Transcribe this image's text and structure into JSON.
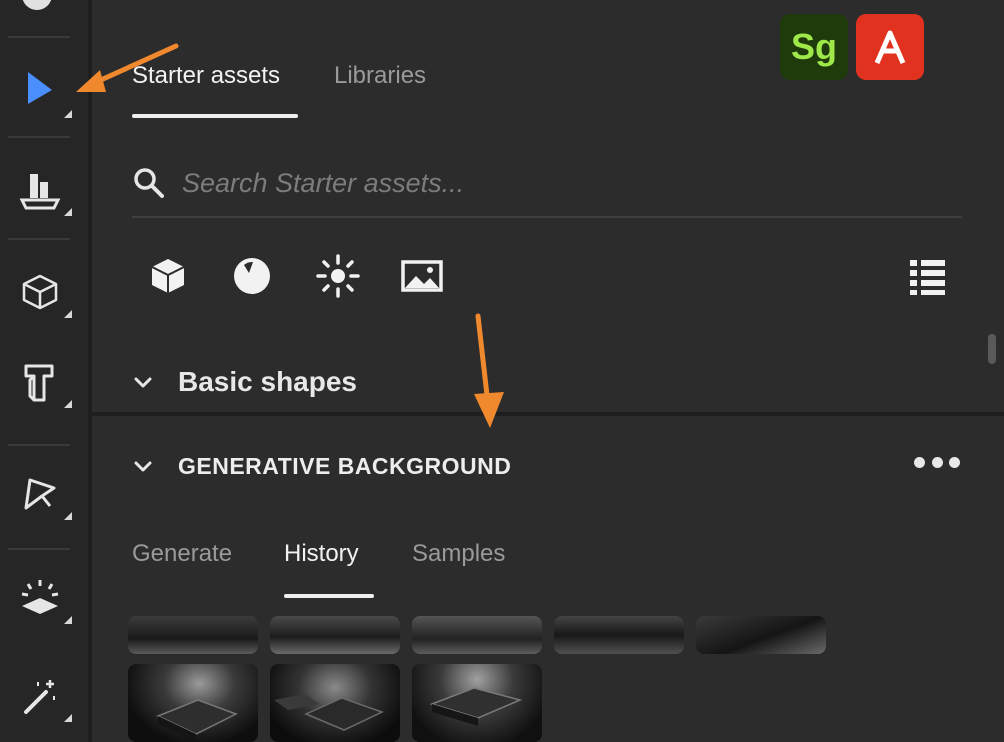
{
  "tabs": [
    {
      "label": "Starter assets",
      "active": true
    },
    {
      "label": "Libraries",
      "active": false
    }
  ],
  "search": {
    "placeholder": "Search Starter assets..."
  },
  "filters": [
    "shape-icon",
    "material-icon",
    "light-icon",
    "environment-icon"
  ],
  "sections": {
    "basic_shapes": {
      "title": "Basic shapes",
      "expanded": false
    },
    "generative_background": {
      "title": "GENERATIVE BACKGROUND",
      "expanded": true
    }
  },
  "sub_tabs": [
    {
      "label": "Generate",
      "active": false
    },
    {
      "label": "History",
      "active": true
    },
    {
      "label": "Samples",
      "active": false
    }
  ],
  "badges": {
    "substance": {
      "text": "Sg",
      "bg": "#1f3a0b",
      "fg": "#9fe84a"
    },
    "adobe": {
      "bg": "#e1321f"
    }
  },
  "toolbar": {
    "tools": [
      "select-tool-icon",
      "stage-tool-icon",
      "cube-tool-icon",
      "shapes-tool-icon",
      "pen-tool-icon",
      "light-tool-icon",
      "magic-wand-tool-icon"
    ],
    "active_tool": "select-tool-icon"
  },
  "colors": {
    "accent_arrow": "#f0892e",
    "active_tool": "#4b8fff",
    "panel_bg": "#2c2c2c"
  },
  "history_thumbnails": 8
}
